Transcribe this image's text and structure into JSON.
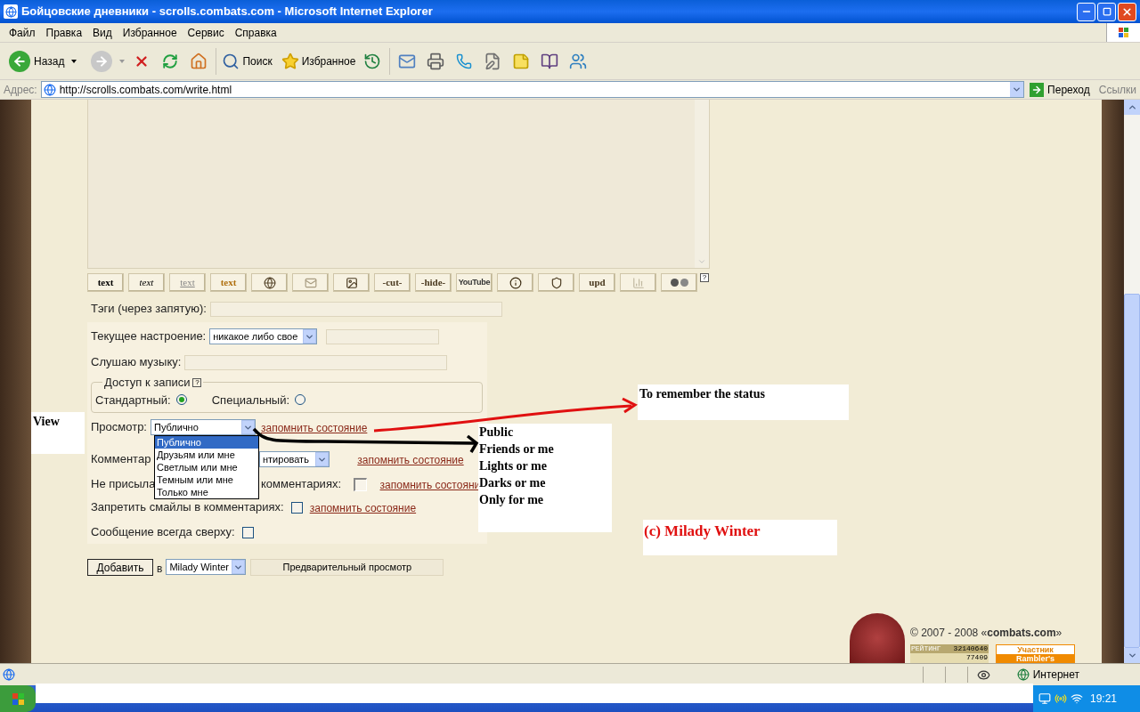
{
  "window": {
    "title": "Бойцовские дневники - scrolls.combats.com - Microsoft Internet Explorer"
  },
  "menu": [
    "Файл",
    "Правка",
    "Вид",
    "Избранное",
    "Сервис",
    "Справка"
  ],
  "toolbar": {
    "back": "Назад",
    "forward_disabled": true,
    "search": "Поиск",
    "favorites": "Избранное"
  },
  "address": {
    "label": "Адрес:",
    "url": "http://scrolls.combats.com/write.html",
    "go": "Переход",
    "links": "Ссылки"
  },
  "editor": {
    "help": "?",
    "buttons": [
      {
        "kind": "text",
        "label": "text"
      },
      {
        "kind": "text",
        "label": "text"
      },
      {
        "kind": "text",
        "label": "text"
      },
      {
        "kind": "text",
        "label": "text"
      },
      {
        "kind": "icon"
      },
      {
        "kind": "icon"
      },
      {
        "kind": "icon"
      },
      {
        "kind": "text",
        "label": "-cut-"
      },
      {
        "kind": "text",
        "label": "-hide-"
      },
      {
        "kind": "text",
        "label": "YouTube"
      },
      {
        "kind": "icon"
      },
      {
        "kind": "icon"
      },
      {
        "kind": "text",
        "label": "upd"
      },
      {
        "kind": "icon"
      },
      {
        "kind": "icon"
      }
    ]
  },
  "form": {
    "tags": {
      "label": "Тэги (через запятую):"
    },
    "mood": {
      "label": "Текущее настроение:",
      "value": "никакое либо свое"
    },
    "music": {
      "label": "Слушаю музыку:"
    },
    "access": {
      "legend": "Доступ к записи",
      "help": "?",
      "options": [
        {
          "label": "Стандартный:",
          "selected": true
        },
        {
          "label": "Специальный:",
          "selected": false
        }
      ]
    },
    "view": {
      "label": "Просмотр:",
      "value": "Публично",
      "remember": "запомнить состояние",
      "options": [
        {
          "label": "Публично",
          "selected": true
        },
        {
          "label": "Друзьям или мне",
          "selected": false
        },
        {
          "label": "Светлым или мне",
          "selected": false
        },
        {
          "label": "Темным или мне",
          "selected": false
        },
        {
          "label": "Только мне",
          "selected": false
        }
      ]
    },
    "comments": {
      "label": "Комментар",
      "value": "нтировать",
      "remember": "запомнить состояние"
    },
    "no_send": {
      "label_start": "Не присыла",
      "label_end": "комментариях:",
      "checked": false,
      "remember": "запомнить состояни"
    },
    "no_smiles": {
      "label": "Запретить смайлы в комментариях:",
      "checked": false,
      "remember": "запомнить состояние"
    },
    "on_top": {
      "label": "Сообщение всегда сверху:",
      "checked": false
    },
    "submit": {
      "button": "Добавить",
      "in": "в",
      "journal": "Milady Winter",
      "preview": "Предварительный просмотр"
    }
  },
  "annotations": {
    "view": "View",
    "remember": "To remember the status",
    "translations": [
      "Public",
      "Friends or me",
      "Lights or me",
      "Darks or me",
      "Only for me"
    ],
    "credit": "(c) Milady Winter"
  },
  "footer": {
    "copyright": "© 2007 - 2008 «**combats.com**»",
    "rating_label": "РЕЙТИНГ",
    "rating_value": "32140640",
    "rating_count": "77409",
    "rambler": [
      "Участник",
      "Rambler's"
    ]
  },
  "status_bar": {
    "zone": "Интернет"
  },
  "taskbar": {
    "clock": "19:21"
  }
}
